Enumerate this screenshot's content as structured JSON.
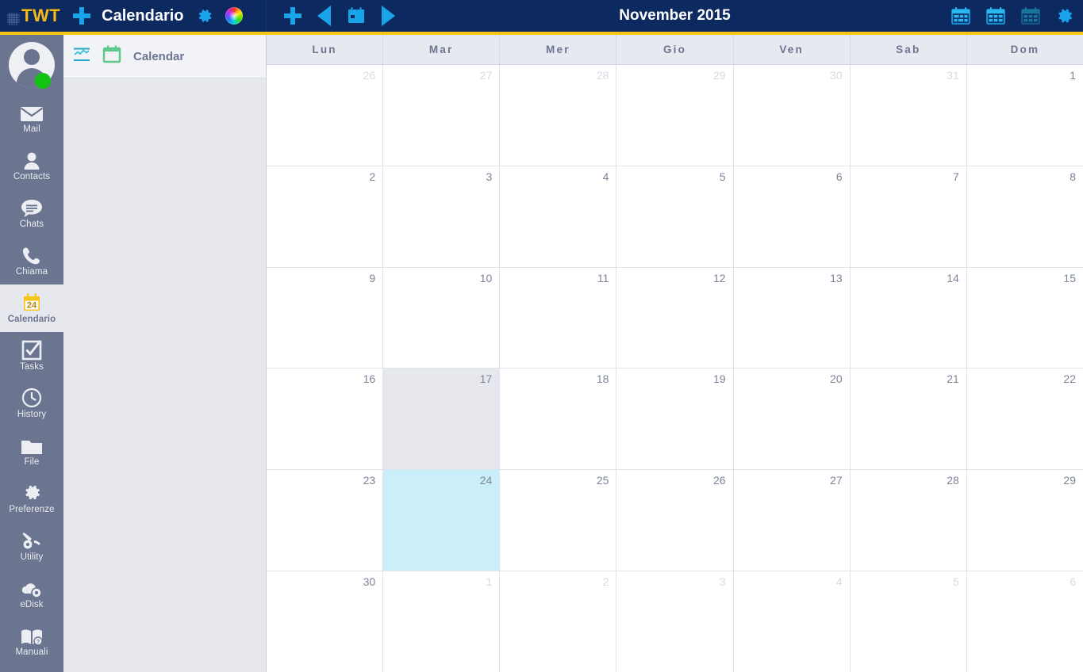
{
  "topbar": {
    "brand": "TWT",
    "brand_icon": "grid-icon",
    "add_icon": "plus-icon",
    "app_title": "Calendario",
    "settings_icon": "gear-icon",
    "theme_icon": "color-wheel-icon",
    "new_event_icon": "plus-icon",
    "prev_icon": "previous-triangle-icon",
    "today_icon": "calendar-today-icon",
    "next_icon": "next-triangle-icon",
    "month_title": "November 2015",
    "view_day_icon": "calendar-day-view-icon",
    "view_week_icon": "calendar-week-view-icon",
    "view_month_icon": "calendar-month-view-icon",
    "calendar_settings_icon": "gear-icon",
    "accent_blue": "#19a4ea",
    "bar_bg": "#0d2a60",
    "rule_yellow": "#f5c518"
  },
  "rail": {
    "avatar": {
      "name": "avatar",
      "status": "online",
      "status_color": "#12c312"
    },
    "items": [
      {
        "label": "Mail",
        "icon": "envelope-icon",
        "active": false
      },
      {
        "label": "Contacts",
        "icon": "person-icon",
        "active": false
      },
      {
        "label": "Chats",
        "icon": "chat-bubble-icon",
        "active": false
      },
      {
        "label": "Chiama",
        "icon": "phone-icon",
        "active": false
      },
      {
        "label": "Calendario",
        "icon": "calendar-icon",
        "active": true,
        "badge": "24"
      },
      {
        "label": "Tasks",
        "icon": "checkbox-icon",
        "active": false
      },
      {
        "label": "History",
        "icon": "clock-icon",
        "active": false
      },
      {
        "label": "File",
        "icon": "folder-icon",
        "active": false
      },
      {
        "label": "Preferenze",
        "icon": "gear-icon",
        "active": false
      },
      {
        "label": "Utility",
        "icon": "tools-gear-icon",
        "active": false
      },
      {
        "label": "eDisk",
        "icon": "cloud-disk-icon",
        "active": false
      },
      {
        "label": "Manuali",
        "icon": "book-help-icon",
        "active": false
      }
    ]
  },
  "panel": {
    "chart_icon": "chart-icon",
    "entry_icon": "calendar-green-icon",
    "entry_label": "Calendar"
  },
  "calendar": {
    "day_headers": [
      "Lun",
      "Mar",
      "Mer",
      "Gio",
      "Ven",
      "Sab",
      "Dom"
    ],
    "weeks": [
      [
        {
          "n": "26",
          "other": true
        },
        {
          "n": "27",
          "other": true
        },
        {
          "n": "28",
          "other": true
        },
        {
          "n": "29",
          "other": true
        },
        {
          "n": "30",
          "other": true
        },
        {
          "n": "31",
          "other": true
        },
        {
          "n": "1",
          "other": false
        }
      ],
      [
        {
          "n": "2",
          "other": false
        },
        {
          "n": "3",
          "other": false
        },
        {
          "n": "4",
          "other": false
        },
        {
          "n": "5",
          "other": false
        },
        {
          "n": "6",
          "other": false
        },
        {
          "n": "7",
          "other": false
        },
        {
          "n": "8",
          "other": false
        }
      ],
      [
        {
          "n": "9",
          "other": false
        },
        {
          "n": "10",
          "other": false
        },
        {
          "n": "11",
          "other": false
        },
        {
          "n": "12",
          "other": false
        },
        {
          "n": "13",
          "other": false
        },
        {
          "n": "14",
          "other": false
        },
        {
          "n": "15",
          "other": false
        }
      ],
      [
        {
          "n": "16",
          "other": false
        },
        {
          "n": "17",
          "other": false,
          "hover": true
        },
        {
          "n": "18",
          "other": false
        },
        {
          "n": "19",
          "other": false
        },
        {
          "n": "20",
          "other": false
        },
        {
          "n": "21",
          "other": false
        },
        {
          "n": "22",
          "other": false
        }
      ],
      [
        {
          "n": "23",
          "other": false
        },
        {
          "n": "24",
          "other": false,
          "today": true
        },
        {
          "n": "25",
          "other": false
        },
        {
          "n": "26",
          "other": false
        },
        {
          "n": "27",
          "other": false
        },
        {
          "n": "28",
          "other": false
        },
        {
          "n": "29",
          "other": false
        }
      ],
      [
        {
          "n": "30",
          "other": false
        },
        {
          "n": "1",
          "other": true
        },
        {
          "n": "2",
          "other": true
        },
        {
          "n": "3",
          "other": true
        },
        {
          "n": "4",
          "other": true
        },
        {
          "n": "5",
          "other": true
        },
        {
          "n": "6",
          "other": true
        }
      ]
    ],
    "today_color": "#cbeefb",
    "hover_color": "#e6e8ee"
  }
}
